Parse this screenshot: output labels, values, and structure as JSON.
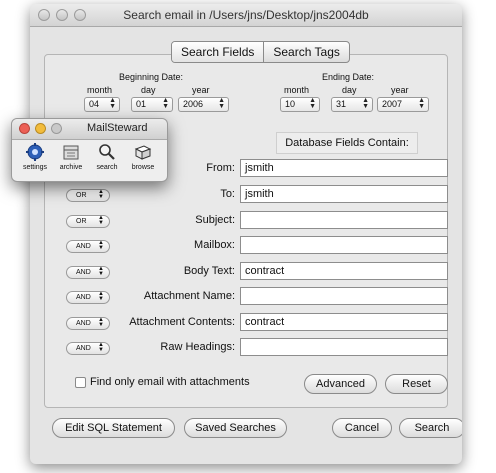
{
  "window": {
    "title": "Search email in /Users/jns/Desktop/jns2004db"
  },
  "tabs": [
    "Search Fields",
    "Search Tags"
  ],
  "beginning_date": {
    "heading": "Beginning Date:",
    "month_label": "month",
    "day_label": "day",
    "year_label": "year",
    "month": "04",
    "day": "01",
    "year": "2006"
  },
  "ending_date": {
    "heading": "Ending Date:",
    "month_label": "month",
    "day_label": "day",
    "year_label": "year",
    "month": "10",
    "day": "31",
    "year": "2007"
  },
  "fields_heading": "Database Fields Contain:",
  "fields": [
    {
      "label": "From:",
      "value": "jsmith",
      "operator": ""
    },
    {
      "label": "To:",
      "value": "jsmith",
      "operator": "OR"
    },
    {
      "label": "Subject:",
      "value": "",
      "operator": "OR"
    },
    {
      "label": "Mailbox:",
      "value": "",
      "operator": "AND"
    },
    {
      "label": "Body Text:",
      "value": "contract",
      "operator": "AND"
    },
    {
      "label": "Attachment Name:",
      "value": "",
      "operator": "AND"
    },
    {
      "label": "Attachment Contents:",
      "value": "contract",
      "operator": "AND"
    },
    {
      "label": "Raw Headings:",
      "value": "",
      "operator": "AND"
    }
  ],
  "attachments_checkbox": {
    "label": "Find only email with attachments",
    "checked": false
  },
  "buttons": {
    "advanced": "Advanced",
    "reset": "Reset",
    "edit_sql": "Edit SQL Statement",
    "saved_searches": "Saved Searches",
    "cancel": "Cancel",
    "search": "Search"
  },
  "palette": {
    "title": "MailSteward",
    "tools": [
      {
        "label": "settings",
        "icon": "gear-icon"
      },
      {
        "label": "archive",
        "icon": "archive-icon"
      },
      {
        "label": "search",
        "icon": "magnifier-icon"
      },
      {
        "label": "browse",
        "icon": "browse-icon"
      }
    ]
  },
  "colors": {
    "close": "#ec5f55",
    "minimize": "#f2bc3c",
    "zoom": "#c9c9c9",
    "settings_icon": "#2d5fb8"
  }
}
